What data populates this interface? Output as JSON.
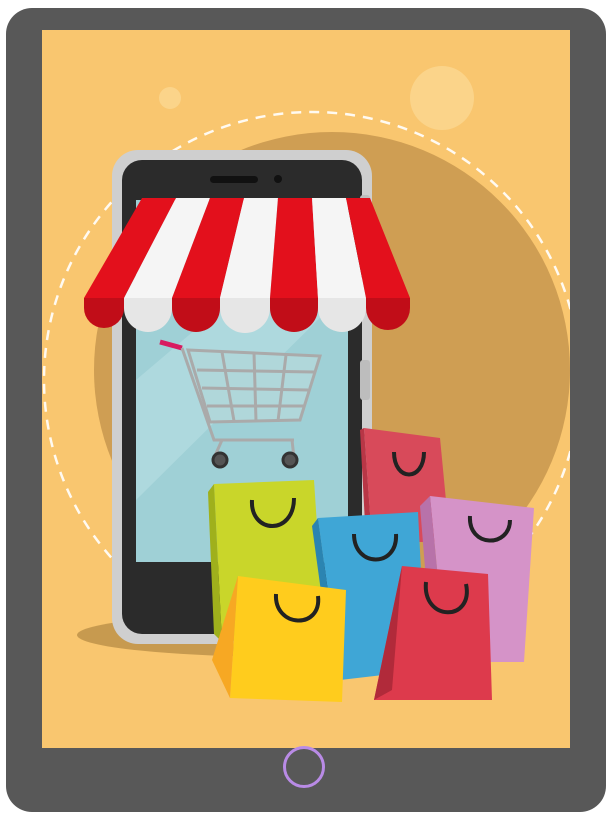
{
  "illustration": {
    "subject": "online-shopping",
    "elements": [
      "tablet-frame",
      "smartphone",
      "shop-awning",
      "shopping-cart",
      "shopping-bags"
    ]
  },
  "colors": {
    "tablet": "#585858",
    "background": "#f9c66f",
    "circle": "#cf9e53",
    "awning_red": "#e3101c",
    "awning_white": "#f5f5f5",
    "phone_body": "#2b2b2b",
    "phone_screen": "#9fd0d6",
    "home_button": "#b98be6",
    "bag_colors": [
      "#d84a5a",
      "#c9d62a",
      "#3fa6d6",
      "#d593c8",
      "#ffcc1d",
      "#dd3a4c"
    ]
  }
}
